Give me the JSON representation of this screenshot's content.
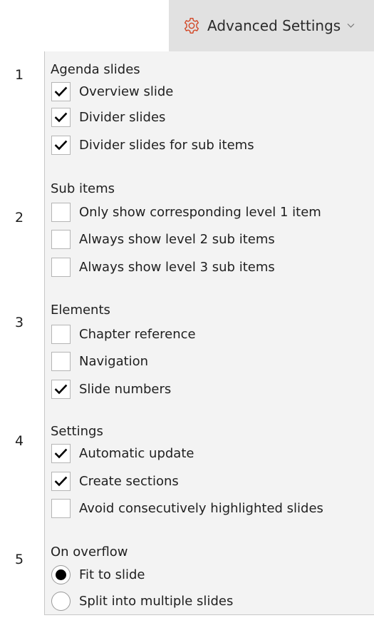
{
  "header": {
    "advanced_settings_label": "Advanced Settings",
    "gear_icon": "gear-icon",
    "chevron_icon": "chevron-down-icon",
    "accent_color": "#d24726"
  },
  "groups": [
    {
      "number": "1",
      "title": "Agenda slides",
      "options": [
        {
          "label": "Overview slide",
          "checked": true
        },
        {
          "label": "Divider slides",
          "checked": true
        },
        {
          "label": "Divider slides for sub items",
          "checked": true
        }
      ]
    },
    {
      "number": "2",
      "title": "Sub items",
      "options": [
        {
          "label": "Only show corresponding level 1 item",
          "checked": false
        },
        {
          "label": "Always show level 2 sub items",
          "checked": false
        },
        {
          "label": "Always show level 3 sub items",
          "checked": false
        }
      ]
    },
    {
      "number": "3",
      "title": "Elements",
      "options": [
        {
          "label": "Chapter reference",
          "checked": false
        },
        {
          "label": "Navigation",
          "checked": false
        },
        {
          "label": "Slide numbers",
          "checked": true
        }
      ]
    },
    {
      "number": "4",
      "title": "Settings",
      "options": [
        {
          "label": "Automatic update",
          "checked": true
        },
        {
          "label": "Create sections",
          "checked": true
        },
        {
          "label": "Avoid consecutively highlighted slides",
          "checked": false
        }
      ]
    },
    {
      "number": "5",
      "title": "On overflow",
      "options": [
        {
          "label": "Fit to slide",
          "selected": true
        },
        {
          "label": "Split into multiple slides",
          "selected": false
        }
      ]
    }
  ]
}
